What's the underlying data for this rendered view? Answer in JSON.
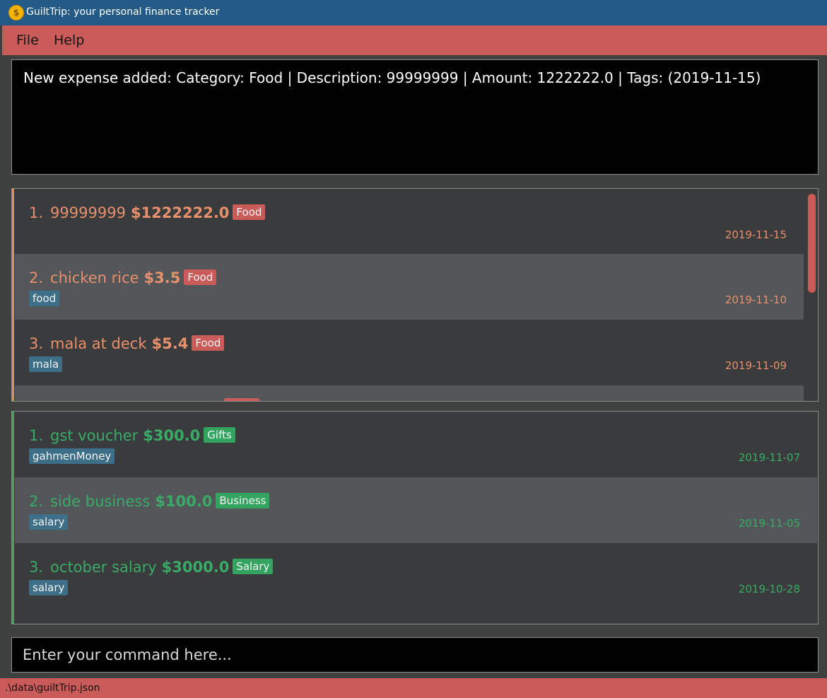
{
  "window": {
    "title": "GuiltTrip: your personal finance tracker",
    "icon": "coin-icon"
  },
  "menu": {
    "items": [
      "File",
      "Help"
    ]
  },
  "result": {
    "text": "New expense added: Category: Food | Description: 99999999 | Amount: 1222222.0 | Tags:  (2019-11-15)"
  },
  "expenses": [
    {
      "index": "1.",
      "desc": "99999999",
      "amount": "$1222222.0",
      "category": "Food",
      "tag": "",
      "date": "2019-11-15"
    },
    {
      "index": "2.",
      "desc": "chicken rice",
      "amount": "$3.5",
      "category": "Food",
      "tag": "food",
      "date": "2019-11-10"
    },
    {
      "index": "3.",
      "desc": "mala at deck",
      "amount": "$5.4",
      "category": "Food",
      "tag": "mala",
      "date": "2019-11-09"
    }
  ],
  "incomes": [
    {
      "index": "1.",
      "desc": "gst voucher",
      "amount": "$300.0",
      "category": "Gifts",
      "tag": "gahmenMoney",
      "date": "2019-11-07"
    },
    {
      "index": "2.",
      "desc": "side business",
      "amount": "$100.0",
      "category": "Business",
      "tag": "salary",
      "date": "2019-11-05"
    },
    {
      "index": "3.",
      "desc": "october salary",
      "amount": "$3000.0",
      "category": "Salary",
      "tag": "salary",
      "date": "2019-10-28"
    }
  ],
  "command": {
    "placeholder": "Enter your command here...",
    "value": ""
  },
  "status": {
    "path": ".\\data\\guiltTrip.json"
  },
  "colors": {
    "title_bar": "#245a86",
    "menu_bar": "#c95b59",
    "expense_text": "#e8906e",
    "income_text": "#3aaa68",
    "tag_bg": "#3d7088",
    "panel_bg": "#3a3b3c",
    "alt_row_bg": "#535759"
  }
}
